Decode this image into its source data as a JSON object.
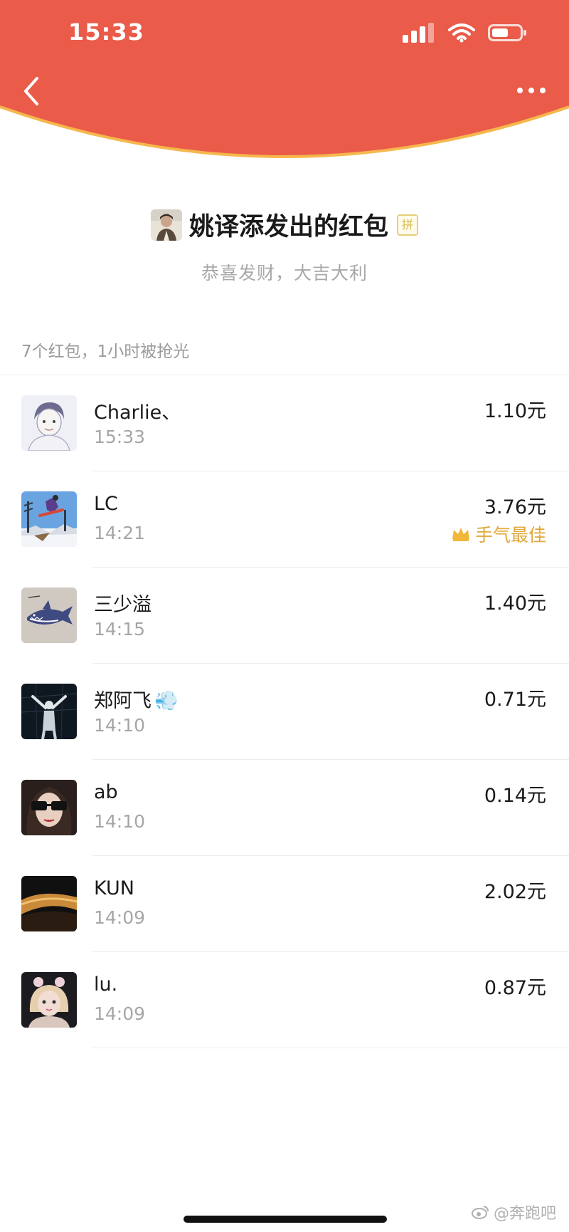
{
  "status_bar": {
    "time": "15:33"
  },
  "colors": {
    "header_red": "#EA5B4A",
    "header_rim": "#F6B74C",
    "best_gold": "#E0A83A"
  },
  "header": {
    "back_icon": "chevron-left-icon",
    "more_icon": "more-horizontal-icon"
  },
  "sender": {
    "title": "姚译添发出的红包",
    "pin_badge": "拼",
    "blessing": "恭喜发财，大吉大利"
  },
  "summary": "7个红包，1小时被抢光",
  "recipients": [
    {
      "name": "Charlie、",
      "time": "15:33",
      "amount": "1.10元",
      "avatar": "sketch-portrait"
    },
    {
      "name": "LC",
      "time": "14:21",
      "amount": "3.76元",
      "best_label": "手气最佳",
      "avatar": "snowboard-jump"
    },
    {
      "name": "三少溢",
      "time": "14:15",
      "amount": "1.40元",
      "avatar": "shark-drawing"
    },
    {
      "name": "郑阿飞",
      "emoji": "💨",
      "time": "14:10",
      "amount": "0.71元",
      "avatar": "night-figure"
    },
    {
      "name": "ab",
      "time": "14:10",
      "amount": "0.14元",
      "avatar": "girl-sunglasses"
    },
    {
      "name": "KUN",
      "time": "14:09",
      "amount": "2.02元",
      "avatar": "desert-dune"
    },
    {
      "name": "lu.",
      "time": "14:09",
      "amount": "0.87元",
      "avatar": "blonde-child"
    }
  ],
  "watermark": "@奔跑吧"
}
